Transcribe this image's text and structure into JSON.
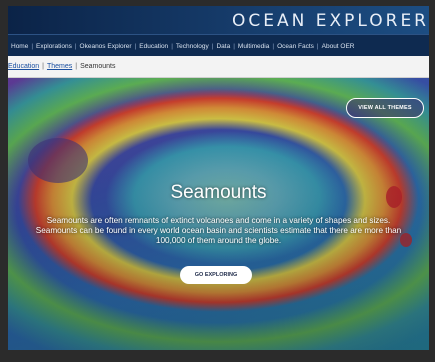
{
  "header": {
    "title": "OCEAN EXPLORER"
  },
  "nav": {
    "items": [
      "Home",
      "Explorations",
      "Okeanos Explorer",
      "Education",
      "Technology",
      "Data",
      "Multimedia",
      "Ocean Facts",
      "About OER"
    ]
  },
  "breadcrumb": {
    "items": [
      "Education",
      "Themes",
      "Seamounts"
    ]
  },
  "hero": {
    "view_all_label": "VIEW ALL THEMES",
    "title": "Seamounts",
    "description": "Seamounts are often remnants of extinct volcanoes and come in a variety of shapes and sizes. Seamounts can be found in every world ocean basin and scientists estimate that there are more than 100,000 of them around the globe.",
    "cta_label": "GO EXPLORING"
  }
}
